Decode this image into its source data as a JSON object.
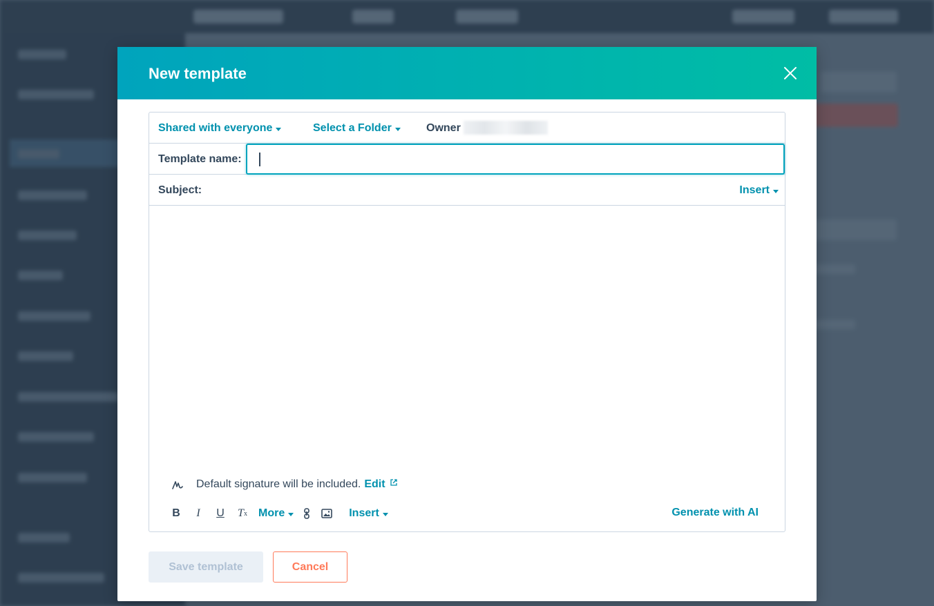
{
  "modal": {
    "title": "New template",
    "close_icon": "close-icon"
  },
  "settings_row": {
    "sharing_label": "Shared with everyone",
    "folder_label": "Select a Folder",
    "owner_label": "Owner"
  },
  "template_name": {
    "label": "Template name:",
    "value": ""
  },
  "subject": {
    "label": "Subject:",
    "insert_label": "Insert"
  },
  "signature": {
    "icon": "signature-icon",
    "text": "Default signature will be included.",
    "edit_label": "Edit",
    "edit_icon": "external-link-icon"
  },
  "toolbar": {
    "bold": "B",
    "italic": "I",
    "underline": "U",
    "clear_format": "T",
    "more_label": "More",
    "link_icon": "link-icon",
    "image_icon": "image-icon",
    "insert_label": "Insert",
    "generate_label": "Generate with AI"
  },
  "footer": {
    "save_label": "Save template",
    "cancel_label": "Cancel"
  },
  "colors": {
    "header_gradient_start": "#00a4bd",
    "header_gradient_end": "#00bda5",
    "link": "#0091ae",
    "cancel": "#ff7a59",
    "disabled_bg": "#eaf0f6",
    "disabled_text": "#b0c1d4"
  }
}
